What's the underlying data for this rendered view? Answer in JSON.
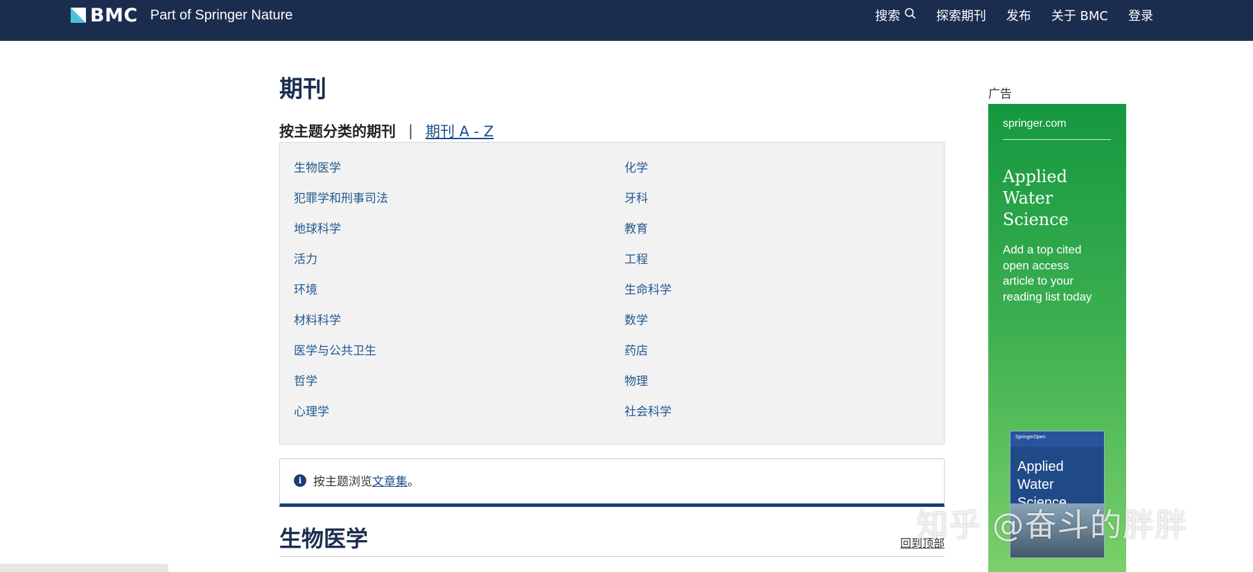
{
  "header": {
    "logo_text": "BMC",
    "logo_sub": "Part of Springer Nature",
    "nav": [
      {
        "label": "搜索",
        "icon": "search-icon"
      },
      {
        "label": "探索期刊"
      },
      {
        "label": "发布"
      },
      {
        "label": "关于 BMC"
      },
      {
        "label": "登录"
      }
    ]
  },
  "main": {
    "title": "期刊",
    "subnav": {
      "current": "按主题分类的期刊",
      "separator": "|",
      "link": "期刊 A - Z"
    },
    "subjects_left": [
      "生物医学",
      "犯罪学和刑事司法",
      "地球科学",
      "活力",
      "环境",
      "材料科学",
      "医学与公共卫生",
      "哲学",
      "心理学"
    ],
    "subjects_right": [
      "化学",
      "牙科",
      "教育",
      "工程",
      "生命科学",
      "数学",
      "药店",
      "物理",
      "社会科学"
    ],
    "notice": {
      "text": "按主题浏览",
      "link": " 文章集",
      "suffix": "。",
      "icon": "info-icon"
    },
    "section_title": "生物医学",
    "back_to_top": "回到顶部"
  },
  "ad": {
    "label": "广告",
    "url": "springer.com",
    "title": "Applied\nWater\nScience",
    "text": "Add a top cited\nopen access\narticle to your\nreading list today",
    "cover_pub": "SpringerOpen",
    "cover_title": "Applied\nWater Science"
  },
  "watermark": "知乎 @奋斗的胖胖",
  "colors": {
    "header_bg": "#1b2d4f",
    "link": "#22588f",
    "ad_green": "#159840"
  }
}
